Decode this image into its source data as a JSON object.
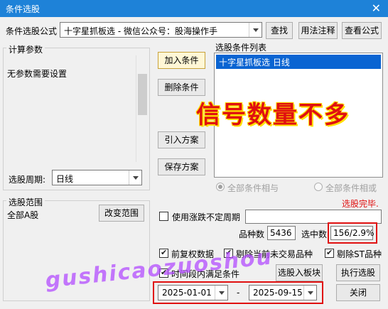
{
  "window": {
    "title": "条件选股",
    "close": "✕"
  },
  "formula": {
    "label": "条件选股公式",
    "value": "十字星抓板选  -  微信公众号：股海操作手",
    "find": "查找",
    "usage": "用法注释",
    "view": "查看公式"
  },
  "params": {
    "title": "计算参数",
    "none": "无参数需要设置",
    "period_label": "选股周期:",
    "period_value": "日线"
  },
  "actions": {
    "add": "加入条件",
    "delete": "删除条件",
    "import": "引入方案",
    "save": "保存方案"
  },
  "cond_list": {
    "title": "选股条件列表",
    "items": [
      "十字星抓板选  日线"
    ]
  },
  "overlay": {
    "headline": "信号数量不多",
    "watermark": "gushicaozuoshou"
  },
  "logic": {
    "and": "全部条件相与",
    "or": "全部条件相或"
  },
  "status": "选股完毕.",
  "range": {
    "title": "选股范围",
    "value": "全部A股",
    "change": "改变范围"
  },
  "period_option": {
    "label": "使用涨跌不定周期",
    "value": ""
  },
  "stats": {
    "count_label": "品种数",
    "count": "5436",
    "selected_label": "选中数",
    "selected": "156/2.9%"
  },
  "options": {
    "fq": "前复权数据",
    "exclude_no_trade": "剔除当前未交易品种",
    "exclude_st": "剔除ST品种",
    "time_range": "时间段内满足条件",
    "to_block": "选股入板块",
    "run": "执行选股"
  },
  "dates": {
    "from": "2025-01-01",
    "sep": "-",
    "to": "2025-09-15"
  },
  "close_btn": "关闭",
  "colors": {
    "title_bar": "#1e82d8",
    "selection": "#0a64d2",
    "alert_red": "#e01010"
  }
}
